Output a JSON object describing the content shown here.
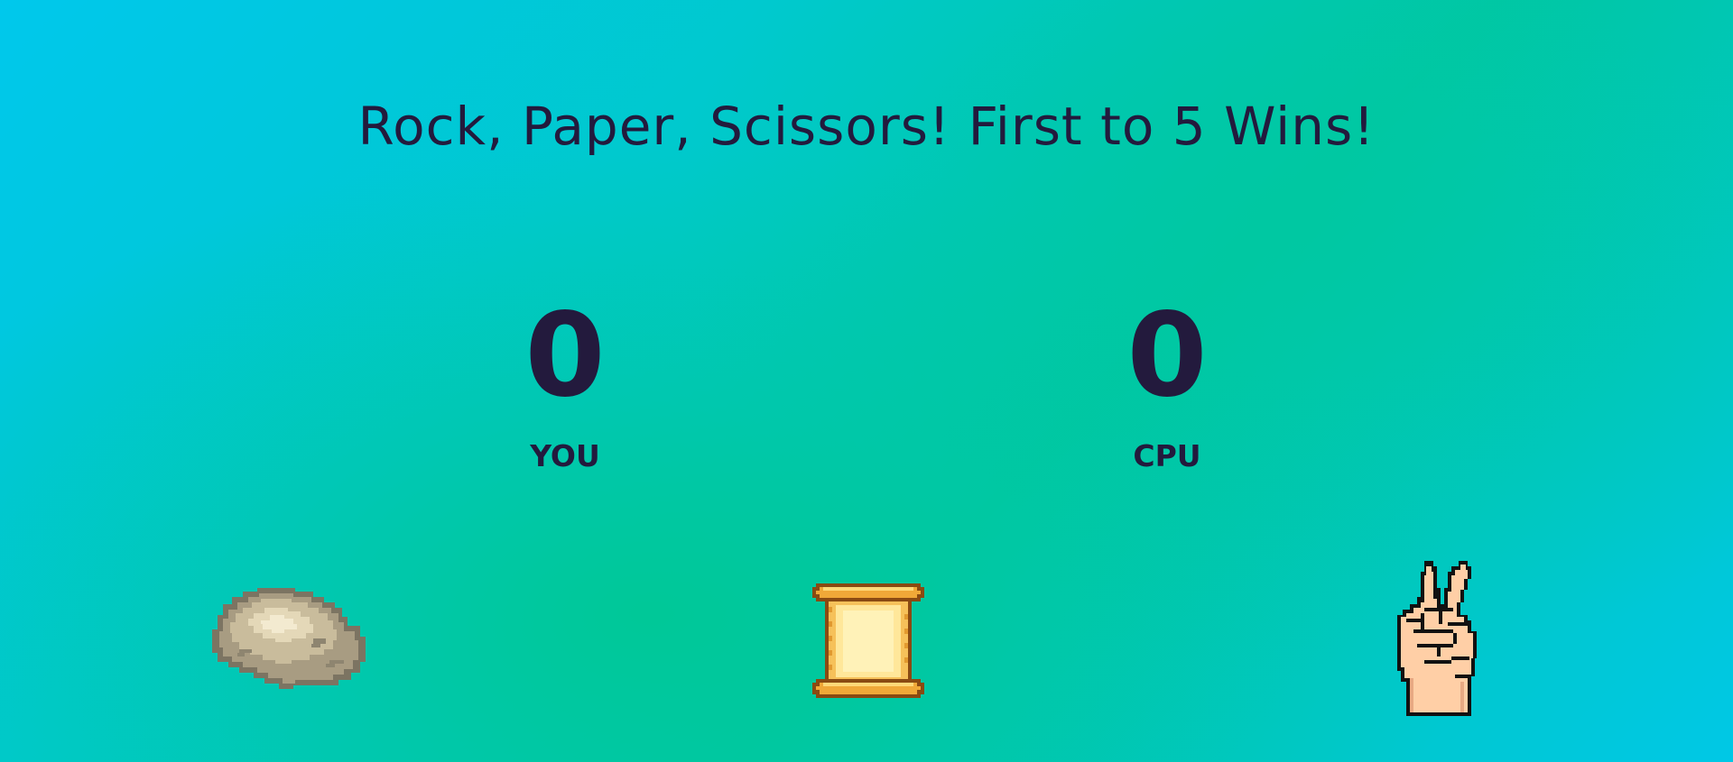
{
  "header": {
    "title": "Rock, Paper, Scissors! First to 5 Wins!"
  },
  "scoreboard": {
    "you": {
      "score": "0",
      "label": "YOU"
    },
    "cpu": {
      "score": "0",
      "label": "CPU"
    }
  },
  "choices": [
    {
      "id": "rock",
      "icon": "rock-icon"
    },
    {
      "id": "paper",
      "icon": "paper-scroll-icon"
    },
    {
      "id": "scissors",
      "icon": "scissors-hand-icon"
    }
  ],
  "colors": {
    "text": "#231a3d",
    "background_cyan": "#00c8ec",
    "background_green": "#00c7a6"
  }
}
